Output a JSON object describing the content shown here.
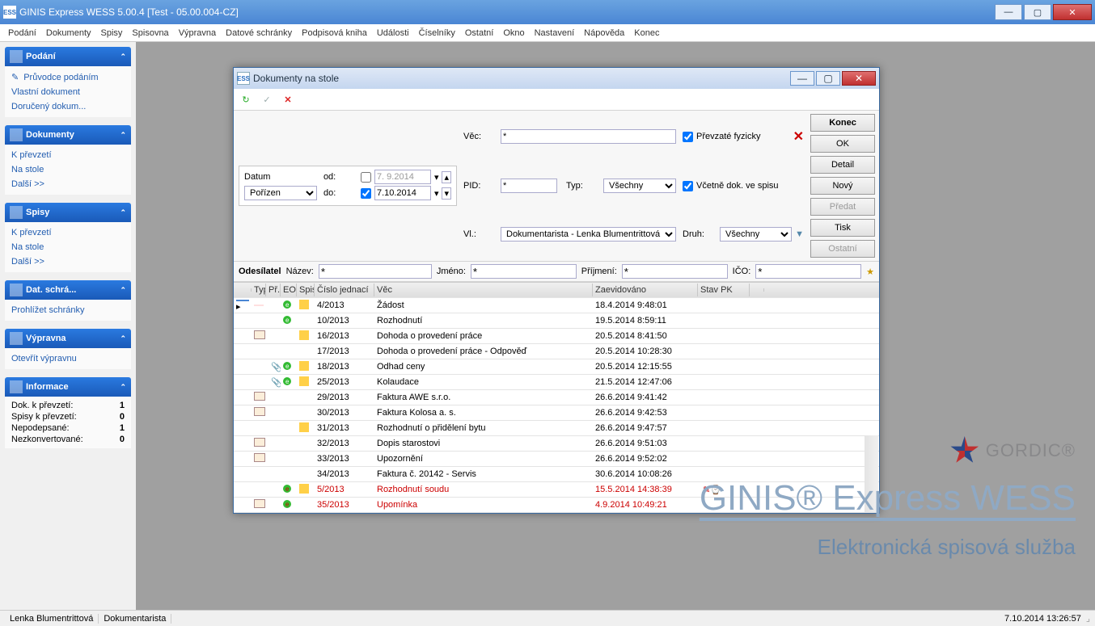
{
  "window": {
    "title": "GINIS Express WESS 5.00.4 [Test - 05.00.004-CZ]"
  },
  "menu": [
    "Podání",
    "Dokumenty",
    "Spisy",
    "Spisovna",
    "Výpravna",
    "Datové schránky",
    "Podpisová kniha",
    "Události",
    "Číselníky",
    "Ostatní",
    "Okno",
    "Nastavení",
    "Nápověda",
    "Konec"
  ],
  "sidebar": {
    "podani": {
      "title": "Podání",
      "items": [
        "Průvodce podáním",
        "Vlastní dokument",
        "Doručený dokum..."
      ]
    },
    "dokumenty": {
      "title": "Dokumenty",
      "items": [
        "K převzetí",
        "Na stole",
        "Další >>"
      ]
    },
    "spisy": {
      "title": "Spisy",
      "items": [
        "K převzetí",
        "Na stole",
        "Další >>"
      ]
    },
    "dat": {
      "title": "Dat. schrá...",
      "items": [
        "Prohlížet schránky"
      ]
    },
    "vypravna": {
      "title": "Výpravna",
      "items": [
        "Otevřít výpravnu"
      ]
    },
    "info": {
      "title": "Informace",
      "rows": [
        {
          "label": "Dok. k převzetí:",
          "val": "1"
        },
        {
          "label": "Spisy k převzetí:",
          "val": "0"
        },
        {
          "label": "Nepodepsané:",
          "val": "1"
        },
        {
          "label": "Nezkonvertované:",
          "val": "0"
        }
      ]
    }
  },
  "branding": {
    "company": "GORDIC®",
    "title": "GINIS® Express WESS",
    "subtitle": "Elektronická spisová služba"
  },
  "inner": {
    "title": "Dokumenty na stole",
    "filters": {
      "datum_label": "Datum",
      "porizen": "Pořízen",
      "od_label": "od:",
      "do_label": "do:",
      "od_val": "7. 9.2014",
      "do_val": "7.10.2014",
      "vec_label": "Věc:",
      "vec_val": "*",
      "pid_label": "PID:",
      "pid_val": "*",
      "typ_label": "Typ:",
      "typ_val": "Všechny",
      "vl_label": "Vl.:",
      "vl_val": "Dokumentarista - Lenka Blumentrittová",
      "druh_label": "Druh:",
      "druh_val": "Všechny",
      "chk1": "Převzaté fyzicky",
      "chk2": "Včetně dok. ve spisu"
    },
    "search": {
      "odesilatel": "Odesílatel",
      "nazev_label": "Název:",
      "nazev_val": "*",
      "jmeno_label": "Jméno:",
      "jmeno_val": "*",
      "prijmeni_label": "Příjmení:",
      "prijmeni_val": "*",
      "ico_label": "IČO:",
      "ico_val": "*"
    },
    "buttons": {
      "konec": "Konec",
      "ok": "OK",
      "detail": "Detail",
      "novy": "Nový",
      "predat": "Předat",
      "tisk": "Tisk",
      "ostatni": "Ostatní"
    },
    "columns": [
      "Typ",
      "Př.",
      "EO",
      "Spis",
      "Číslo jednací",
      "Věc",
      "Zaevidováno",
      "Stav PK"
    ],
    "rows": [
      {
        "cur": true,
        "mail": false,
        "clip": false,
        "eo": true,
        "spis": true,
        "cj": "4/2013",
        "vec": "Žádost",
        "dt": "18.4.2014 9:48:01",
        "red": false
      },
      {
        "mail": false,
        "clip": false,
        "eo": true,
        "spis": false,
        "cj": "10/2013",
        "vec": "Rozhodnutí",
        "dt": "19.5.2014 8:59:11",
        "red": false
      },
      {
        "mail": true,
        "clip": false,
        "eo": false,
        "spis": true,
        "cj": "16/2013",
        "vec": "Dohoda o provedení práce",
        "dt": "20.5.2014 8:41:50",
        "red": false
      },
      {
        "mail": false,
        "clip": false,
        "eo": false,
        "spis": false,
        "cj": "17/2013",
        "vec": "Dohoda o provedení práce - Odpověď",
        "dt": "20.5.2014 10:28:30",
        "red": false
      },
      {
        "mail": false,
        "clip": true,
        "eo": true,
        "spis": true,
        "cj": "18/2013",
        "vec": "Odhad ceny",
        "dt": "20.5.2014 12:15:55",
        "red": false
      },
      {
        "mail": false,
        "clip": true,
        "eo": true,
        "spis": true,
        "cj": "25/2013",
        "vec": "Kolaudace",
        "dt": "21.5.2014 12:47:06",
        "red": false
      },
      {
        "mail": true,
        "clip": false,
        "eo": false,
        "spis": false,
        "cj": "29/2013",
        "vec": "Faktura AWE s.r.o.",
        "dt": "26.6.2014 9:41:42",
        "red": false
      },
      {
        "mail": true,
        "clip": false,
        "eo": false,
        "spis": false,
        "cj": "30/2013",
        "vec": "Faktura Kolosa a. s.",
        "dt": "26.6.2014 9:42:53",
        "red": false
      },
      {
        "mail": false,
        "clip": false,
        "eo": false,
        "spis": true,
        "cj": "31/2013",
        "vec": "Rozhodnutí o přidělení bytu",
        "dt": "26.6.2014 9:47:57",
        "red": false
      },
      {
        "mail": true,
        "clip": false,
        "eo": false,
        "spis": false,
        "cj": "32/2013",
        "vec": "Dopis starostovi",
        "dt": "26.6.2014 9:51:03",
        "red": false
      },
      {
        "mail": true,
        "clip": false,
        "eo": false,
        "spis": false,
        "cj": "33/2013",
        "vec": "Upozornění",
        "dt": "26.6.2014 9:52:02",
        "red": false
      },
      {
        "mail": false,
        "clip": false,
        "eo": false,
        "spis": false,
        "cj": "34/2013",
        "vec": "Faktura č. 20142 - Servis",
        "dt": "30.6.2014 10:08:26",
        "red": false
      },
      {
        "mail": false,
        "clip": false,
        "eo": true,
        "spis": true,
        "cj": "5/2013",
        "vec": "Rozhodnutí soudu",
        "dt": "15.5.2014 14:38:39",
        "red": true,
        "pk": true
      },
      {
        "mail": true,
        "clip": false,
        "eo": true,
        "spis": false,
        "cj": "35/2013",
        "vec": "Upomínka",
        "dt": "4.9.2014 10:49:21",
        "red": true
      }
    ]
  },
  "status": {
    "user": "Lenka Blumentrittová",
    "role": "Dokumentarista",
    "datetime": "7.10.2014 13:26:57"
  }
}
